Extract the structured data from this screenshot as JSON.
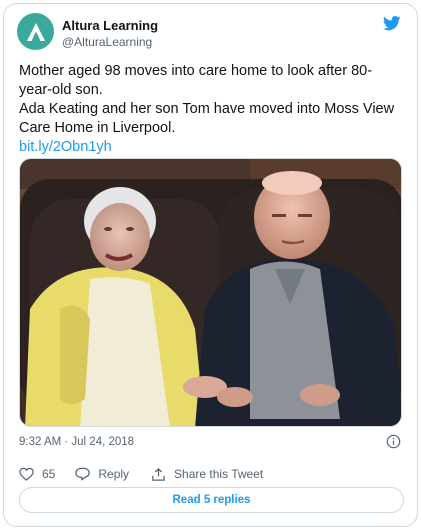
{
  "account": {
    "name": "Altura Learning",
    "handle": "@AlturaLearning"
  },
  "tweet": {
    "line1": "Mother aged 98 moves into care home to look after 80-year-old son.",
    "line2": "Ada Keating and her son Tom have moved into Moss View Care Home in Liverpool.",
    "link": "bit.ly/2Obn1yh",
    "timestamp": "9:32 AM · Jul 24, 2018"
  },
  "actions": {
    "like_count": "65",
    "reply_label": "Reply",
    "share_label": "Share this Tweet",
    "read_replies": "Read 5 replies"
  },
  "colors": {
    "accent": "#1d9bf0",
    "avatar": "#3aa89a",
    "muted_text": "#536471"
  },
  "icons": [
    "altura-logo-icon",
    "twitter-bird-icon",
    "info-icon",
    "heart-icon",
    "reply-icon",
    "share-icon"
  ]
}
